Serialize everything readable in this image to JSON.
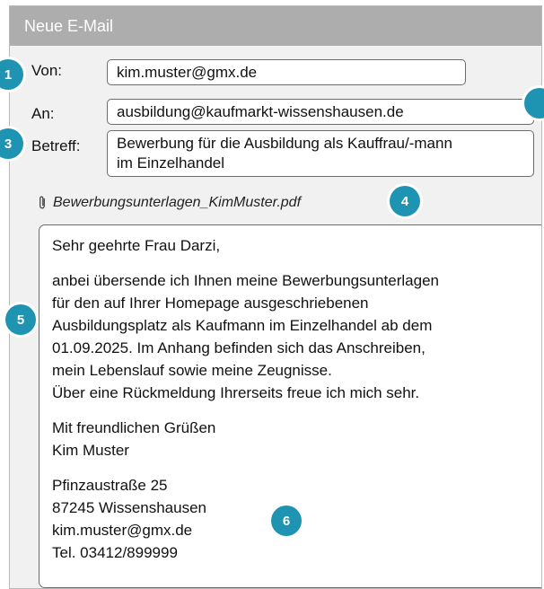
{
  "window": {
    "title": "Neue E-Mail"
  },
  "header": {
    "from_label": "Von:",
    "from_value": "kim.muster@gmx.de",
    "to_label": "An:",
    "to_value": "ausbildung@kaufmarkt-wissenshausen.de",
    "subject_label": "Betreff:",
    "subject_line1": "Bewerbung für die Ausbildung als Kauffrau/-mann",
    "subject_line2": "im Einzelhandel"
  },
  "attachment": {
    "filename": "Bewerbungsunterlagen_KimMuster.pdf",
    "icon": "paperclip-icon"
  },
  "message": {
    "salutation": "Sehr geehrte Frau Darzi,",
    "para_lines": [
      "anbei übersende ich Ihnen meine Bewerbungsunterlagen",
      "für den auf Ihrer Homepage ausgeschriebenen",
      "Ausbildungsplatz als Kaufmann im Einzelhandel ab dem",
      "01.09.2025. Im Anhang befinden sich das Anschreiben,",
      "mein Lebenslauf sowie meine Zeugnisse.",
      "Über eine Rückmeldung Ihrerseits freue ich mich sehr."
    ],
    "closing": "Mit freundlichen Grüßen",
    "name": "Kim Muster",
    "signature": [
      "Pfinzaustraße 25",
      "87245 Wissenshausen",
      "kim.muster@gmx.de",
      "Tel. 03412/899999"
    ]
  },
  "badges": [
    "1",
    "",
    "3",
    "4",
    "5",
    "6"
  ],
  "colors": {
    "badge": "#1f93b2",
    "titlebar": "#adadad",
    "window_bg": "#f1f1f1"
  }
}
